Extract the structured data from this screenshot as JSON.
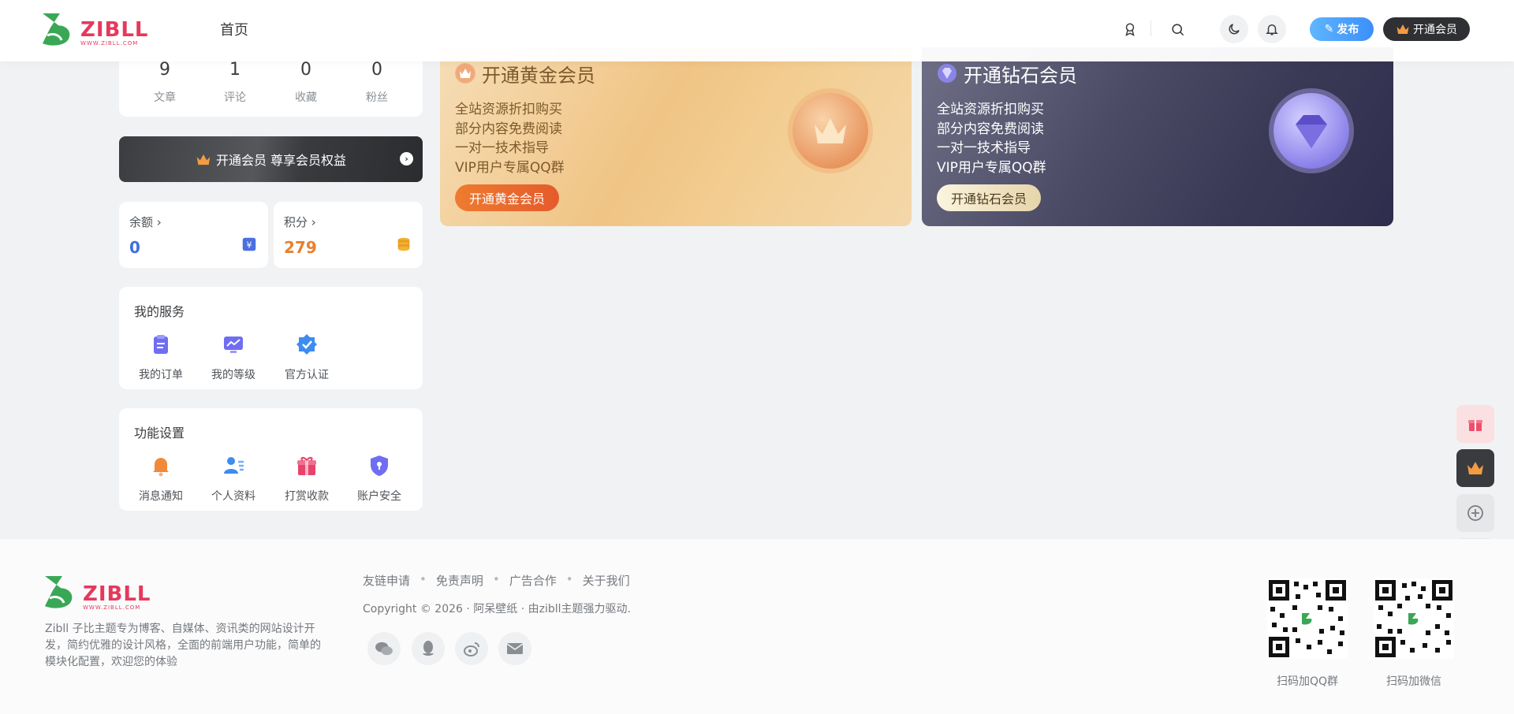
{
  "header": {
    "logo_text": "ZIBLL",
    "logo_sub": "WWW.ZIBLL.COM",
    "nav_home": "首页",
    "publish_label": "发布",
    "vip_label": "开通会员"
  },
  "stats": [
    {
      "value": "9",
      "label": "文章"
    },
    {
      "value": "1",
      "label": "评论"
    },
    {
      "value": "0",
      "label": "收藏"
    },
    {
      "value": "0",
      "label": "粉丝"
    }
  ],
  "vip_banner": {
    "label": "开通会员 尊享会员权益"
  },
  "wallet": {
    "balance": {
      "title": "余额",
      "value": "0"
    },
    "points": {
      "title": "积分",
      "value": "279"
    }
  },
  "services": {
    "title": "我的服务",
    "items": [
      "我的订单",
      "我的等级",
      "官方认证"
    ]
  },
  "functions": {
    "title": "功能设置",
    "items": [
      "消息通知",
      "个人资料",
      "打赏收款",
      "账户安全"
    ]
  },
  "vip_gold": {
    "title": "开通黄金会员",
    "perks": [
      "全站资源折扣购买",
      "部分内容免费阅读",
      "一对一技术指导",
      "VIP用户专属QQ群"
    ],
    "button": "开通黄金会员"
  },
  "vip_diamond": {
    "title": "开通钻石会员",
    "perks": [
      "全站资源折扣购买",
      "部分内容免费阅读",
      "一对一技术指导",
      "VIP用户专属QQ群"
    ],
    "button": "开通钻石会员"
  },
  "footer": {
    "logo_text": "ZIBLL",
    "logo_sub": "WWW.ZIBLL.COM",
    "description": "Zibll 子比主题专为博客、自媒体、资讯类的网站设计开发，简约优雅的设计风格，全面的前端用户功能，简单的模块化配置，欢迎您的体验",
    "links": [
      "友链申请",
      "免责声明",
      "广告合作",
      "关于我们"
    ],
    "copyright": "Copyright © 2026 · 阿呆壁纸 · 由zibll主题强力驱动.",
    "qr_labels": [
      "扫码加QQ群",
      "扫码加微信"
    ]
  },
  "colors": {
    "brand_green": "#3aa757",
    "brand_red": "#e5395c",
    "balance_blue": "#3d6fe0",
    "points_orange": "#ea7f2c",
    "publish_blue": "#3c8ffa"
  }
}
